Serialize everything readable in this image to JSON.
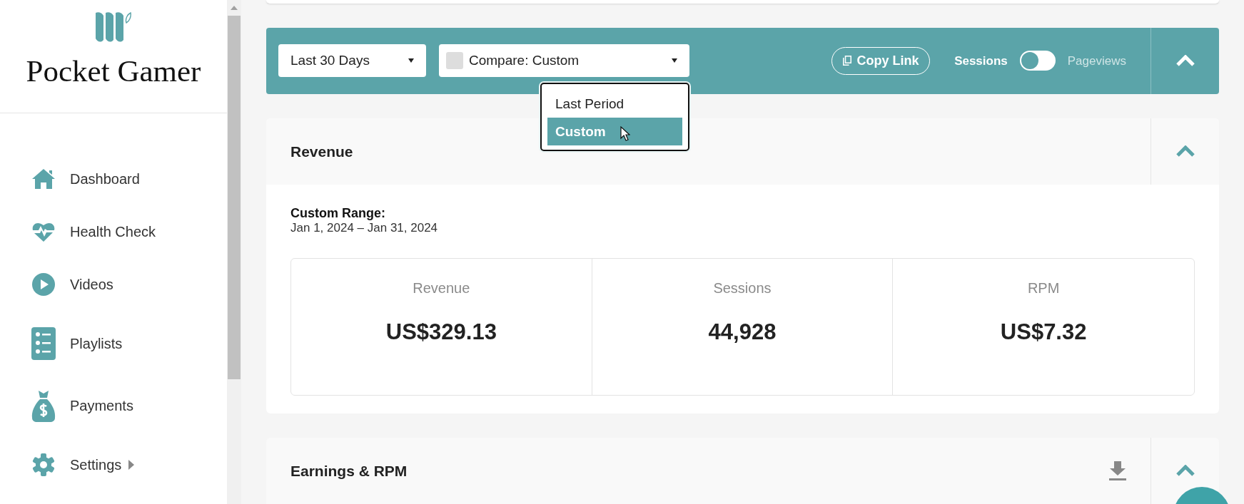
{
  "sidebar": {
    "brand": "Pocket Gamer",
    "items": [
      {
        "label": "Dashboard",
        "has_submenu": false
      },
      {
        "label": "Health Check",
        "has_submenu": false
      },
      {
        "label": "Videos",
        "has_submenu": false
      },
      {
        "label": "Playlists",
        "has_submenu": false
      },
      {
        "label": "Payments",
        "has_submenu": false
      },
      {
        "label": "Settings",
        "has_submenu": true
      }
    ]
  },
  "toolbar": {
    "date_range": "Last 30 Days",
    "compare": {
      "label": "Compare: Custom",
      "checked": false
    },
    "compare_menu": [
      {
        "label": "Last Period",
        "selected": false
      },
      {
        "label": "Custom",
        "selected": true
      }
    ],
    "copy_link": "Copy Link",
    "toggle": {
      "left_label": "Sessions",
      "right_label": "Pageviews",
      "on": false
    },
    "expanded": true
  },
  "revenue": {
    "title": "Revenue",
    "expanded": true,
    "range_label": "Custom Range:",
    "range": "Jan 1, 2024 – Jan 31, 2024",
    "stats": [
      {
        "label": "Revenue",
        "value": "US$329.13"
      },
      {
        "label": "Sessions",
        "value": "44,928"
      },
      {
        "label": "RPM",
        "value": "US$7.32"
      }
    ]
  },
  "earnings": {
    "title": "Earnings & RPM",
    "expanded": true
  }
}
